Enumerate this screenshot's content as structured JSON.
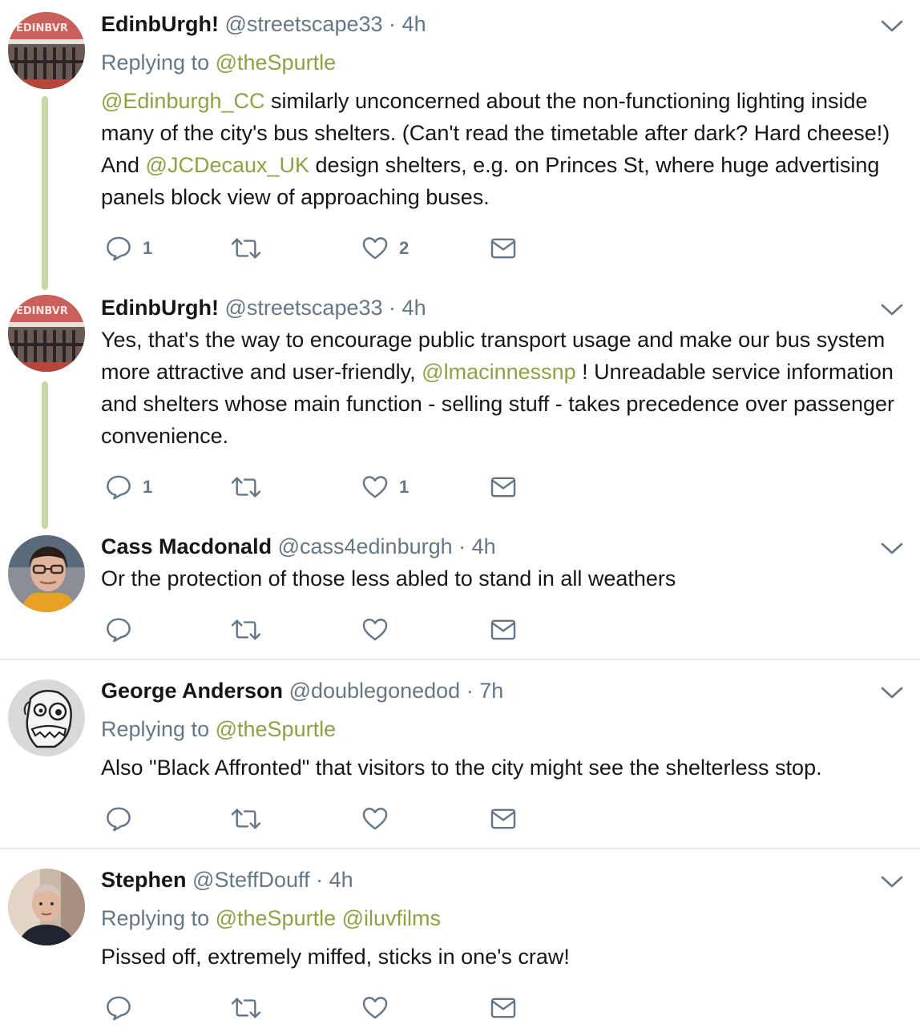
{
  "tweets": [
    {
      "name": "EdinbUrgh!",
      "handle": "@streetscape33",
      "dot": "·",
      "time": "4h",
      "replying_prefix": "Replying to",
      "replying_to": "@theSpurtle",
      "avatar_icon": "edinburgh-sign-avatar",
      "text_parts": {
        "m1": "@Edinburgh_CC",
        "t1": " similarly unconcerned about the non-functioning lighting inside many of the city's bus shelters. (Can't read the timetable after dark? Hard cheese!) And ",
        "m2": "@JCDecaux_UK",
        "t2": " design shelters, e.g. on Princes St, where huge advertising panels block view of approaching buses."
      },
      "reply_count": "1",
      "retweet_count": "",
      "like_count": "2"
    },
    {
      "name": "EdinbUrgh!",
      "handle": "@streetscape33",
      "dot": "·",
      "time": "4h",
      "avatar_icon": "edinburgh-sign-avatar",
      "text_parts": {
        "t1": "Yes, that's the way to encourage public transport usage and make our bus system more attractive and user-friendly, ",
        "m1": "@lmacinnessnp",
        "t2": " !  Unreadable service information and shelters whose main function - selling stuff - takes precedence over passenger convenience."
      },
      "reply_count": "1",
      "retweet_count": "",
      "like_count": "1"
    },
    {
      "name": "Cass Macdonald",
      "handle": "@cass4edinburgh",
      "dot": "·",
      "time": "4h",
      "avatar_icon": "woman-with-glasses-avatar",
      "text": "Or the protection of those less abled to stand in all weathers",
      "reply_count": "",
      "retweet_count": "",
      "like_count": ""
    },
    {
      "name": "George Anderson",
      "handle": "@doublegonedod",
      "dot": "·",
      "time": "7h",
      "replying_prefix": "Replying to",
      "replying_to": "@theSpurtle",
      "avatar_icon": "cartoon-face-avatar",
      "text": "Also \"Black Affronted\" that visitors to the city might see the shelterless stop.",
      "reply_count": "",
      "retweet_count": "",
      "like_count": ""
    },
    {
      "name": "Stephen",
      "handle": "@SteffDouff",
      "dot": "·",
      "time": "4h",
      "replying_prefix": "Replying to",
      "replying_to": "@theSpurtle",
      "replying_to_2": "@iluvfilms",
      "avatar_icon": "man-photo-avatar",
      "text": "Pissed off, extremely miffed, sticks in one's craw!",
      "reply_count": "",
      "retweet_count": "",
      "like_count": ""
    }
  ],
  "icons": {
    "reply": "reply-icon",
    "retweet": "retweet-icon",
    "like": "heart-icon",
    "message": "envelope-icon",
    "more": "chevron-down-icon"
  },
  "colors": {
    "name": "#14171a",
    "muted": "#657786",
    "mention": "#8fa046",
    "thread_line": "#c9d6a8",
    "divider": "#e6ecf0"
  }
}
